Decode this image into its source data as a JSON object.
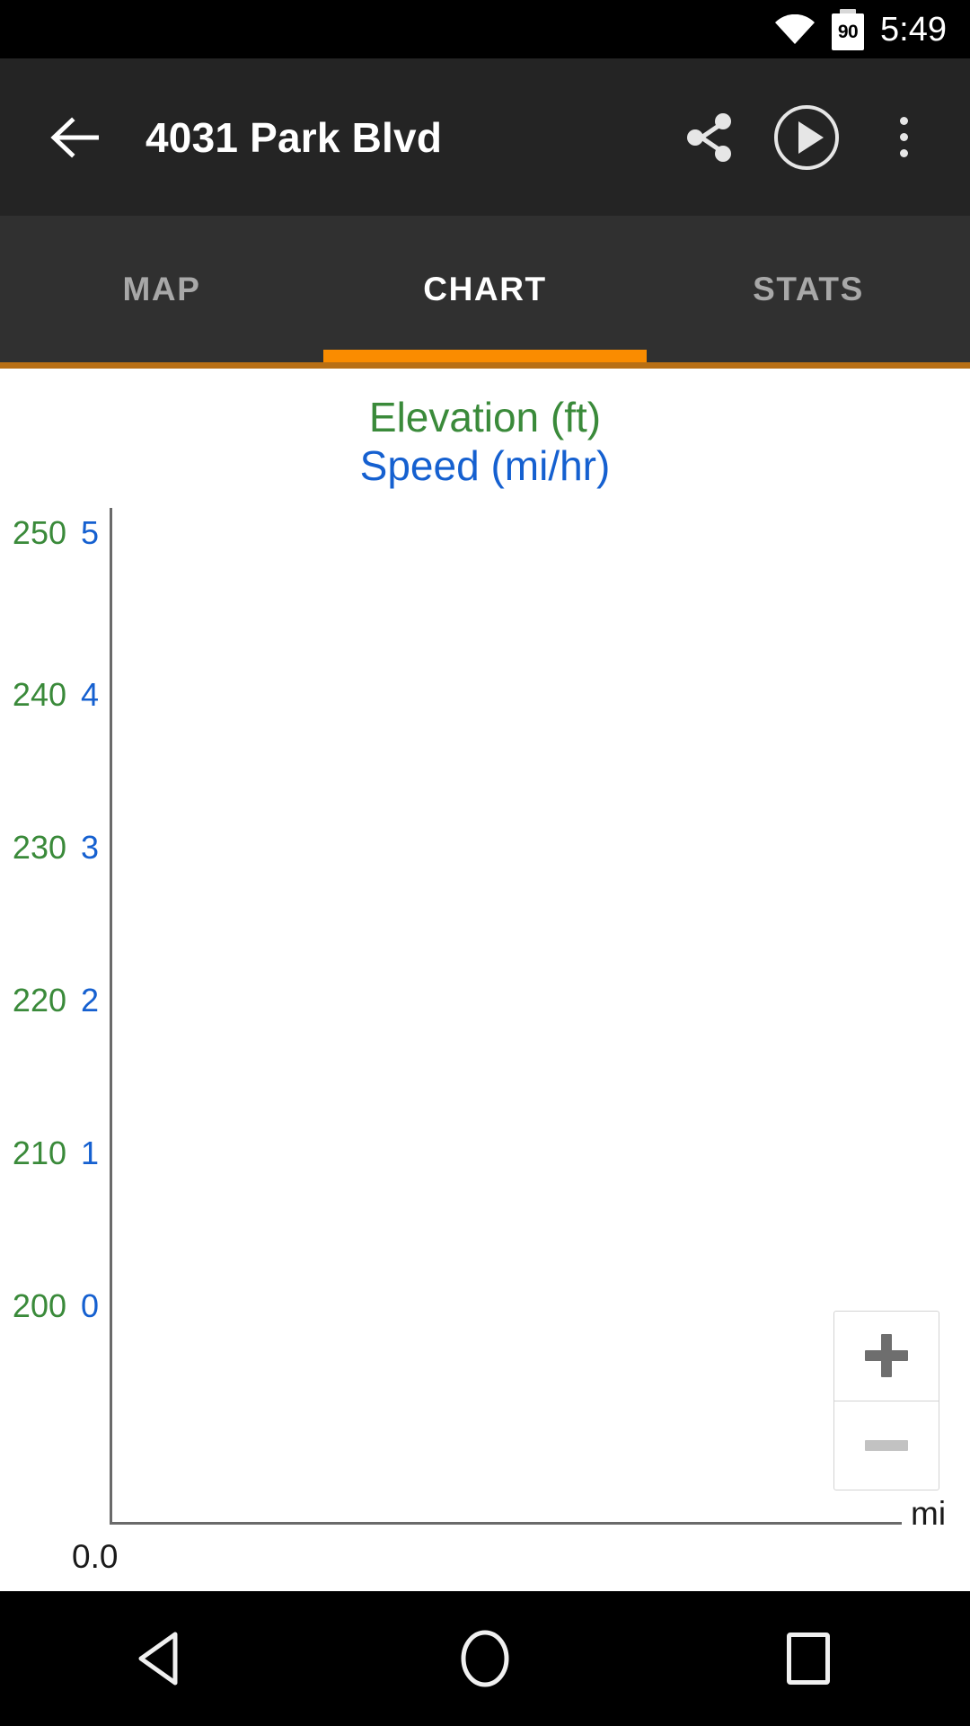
{
  "status_bar": {
    "wifi_icon": "wifi-icon",
    "battery_icon": "battery-icon",
    "battery_level": "90",
    "time": "5:49"
  },
  "app_bar": {
    "back_icon": "back-arrow-icon",
    "title": "4031 Park Blvd",
    "share_icon": "share-icon",
    "play_icon": "play-circle-icon",
    "overflow_icon": "more-vertical-icon"
  },
  "tabs": {
    "items": [
      {
        "label": "MAP",
        "active": false
      },
      {
        "label": "CHART",
        "active": true
      },
      {
        "label": "STATS",
        "active": false
      }
    ],
    "indicator_color": "#fa8c00",
    "underline_color": "#b86f14"
  },
  "zoom_controls": {
    "zoom_in_label": "+",
    "zoom_out_label": "−"
  },
  "nav_bar": {
    "back_icon": "nav-back-triangle-icon",
    "home_icon": "nav-home-circle-icon",
    "recents_icon": "nav-recents-square-icon"
  },
  "chart_data": {
    "type": "line",
    "title": "Elevation (ft)\nSpeed (mi/hr)",
    "title_lines": [
      {
        "text": "Elevation (ft)",
        "color": "#3a8a3a"
      },
      {
        "text": "Speed (mi/hr)",
        "color": "#1560d0"
      }
    ],
    "series": [
      {
        "name": "Elevation (ft)",
        "color": "#3a8a3a",
        "unit": "ft",
        "values": []
      },
      {
        "name": "Speed (mi/hr)",
        "color": "#1560d0",
        "unit": "mi/hr",
        "values": []
      }
    ],
    "x": [],
    "xlabel": "mi",
    "xlim": [
      0.0,
      0.0
    ],
    "x_ticks": [
      "0.0"
    ],
    "y_axes": [
      {
        "name": "Elevation (ft)",
        "color": "#3a8a3a",
        "ticks": [
          250,
          240,
          230,
          220,
          210,
          200
        ],
        "ylim": [
          200,
          250
        ]
      },
      {
        "name": "Speed (mi/hr)",
        "color": "#1560d0",
        "ticks": [
          5,
          4,
          3,
          2,
          1,
          0
        ],
        "ylim": [
          0,
          5
        ]
      }
    ],
    "y_tick_rows": [
      {
        "elevation": "250",
        "speed": "5"
      },
      {
        "elevation": "240",
        "speed": "4"
      },
      {
        "elevation": "230",
        "speed": "3"
      },
      {
        "elevation": "220",
        "speed": "2"
      },
      {
        "elevation": "210",
        "speed": "1"
      },
      {
        "elevation": "200",
        "speed": "0"
      }
    ],
    "grid": false,
    "legend": "none",
    "empty": true
  }
}
